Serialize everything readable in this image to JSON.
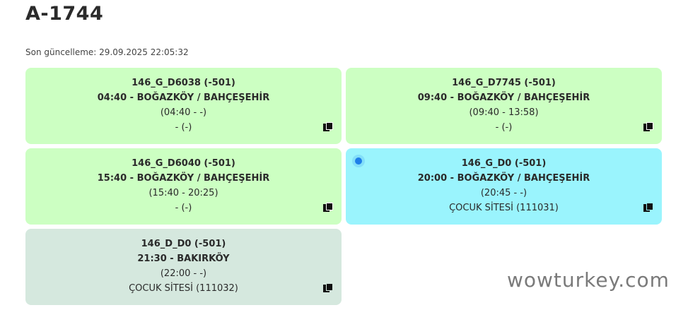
{
  "header": {
    "title": "A-1744",
    "last_updated": "Son güncelleme: 29.09.2025 22:05:32"
  },
  "cards": [
    {
      "code": "146_G_D6038 (-501)",
      "route": "04:40 - BOĞAZKÖY / BAHÇEŞEHİR",
      "times": "(04:40 - -)",
      "stop": "- (-)",
      "color": "#ccffc2"
    },
    {
      "code": "146_G_D7745 (-501)",
      "route": "09:40 - BOĞAZKÖY / BAHÇEŞEHİR",
      "times": "(09:40 - 13:58)",
      "stop": "- (-)",
      "color": "#ccffc2"
    },
    {
      "code": "146_G_D6040 (-501)",
      "route": "15:40 - BOĞAZKÖY / BAHÇEŞEHİR",
      "times": "(15:40 - 20:25)",
      "stop": "- (-)",
      "color": "#ccffc2"
    },
    {
      "code": "146_G_D0 (-501)",
      "route": "20:00 - BOĞAZKÖY / BAHÇEŞEHİR",
      "times": "(20:45 - -)",
      "stop": "ÇOCUK SİTESİ (111031)",
      "color": "#9af4fd",
      "active_indicator": "#1e7fe8"
    },
    {
      "code": "146_D_D0 (-501)",
      "route": "21:30 - BAKIRKÖY",
      "times": "(22:00 - -)",
      "stop": "ÇOCUK SİTESİ (111032)",
      "color": "#d5e8de"
    }
  ],
  "icons": {
    "copy": "copy-icon",
    "active": "live-dot-icon"
  },
  "watermark": "wowturkey.com"
}
